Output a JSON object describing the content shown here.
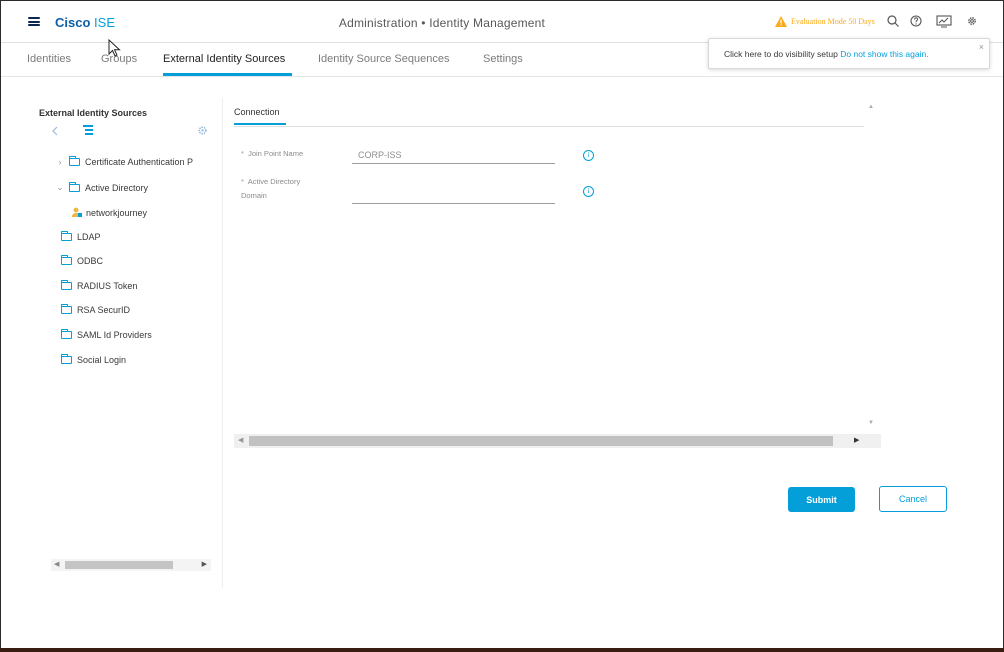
{
  "header": {
    "brand_bold": "Cisco",
    "brand_light": "ISE",
    "title": "Administration • Identity Management",
    "evaluation": "Evaluation Mode 50 Days",
    "icons": [
      "search-icon",
      "help-icon",
      "dashboard-icon",
      "gear-icon"
    ]
  },
  "tabs": [
    {
      "label": "Identities"
    },
    {
      "label": "Groups"
    },
    {
      "label": "External Identity Sources"
    },
    {
      "label": "Identity Source Sequences"
    },
    {
      "label": "Settings"
    }
  ],
  "popup": {
    "message": "Click here to do visibility setup",
    "link": "Do not show this again.",
    "close": "×"
  },
  "sidebar": {
    "title": "External Identity Sources",
    "items": [
      {
        "label": "Certificate Authentication P"
      },
      {
        "label": "Active Directory"
      },
      {
        "label": "networkjourney"
      },
      {
        "label": "LDAP"
      },
      {
        "label": "ODBC"
      },
      {
        "label": "RADIUS Token"
      },
      {
        "label": "RSA SecurID"
      },
      {
        "label": "SAML Id Providers"
      },
      {
        "label": "Social Login"
      }
    ]
  },
  "connection": {
    "tab_label": "Connection",
    "join_point_label": "Join Point Name",
    "join_point_value": "CORP-ISS",
    "ad_domain_label_1": "Active Directory",
    "ad_domain_label_2": "Domain",
    "ad_domain_value": "",
    "required_marker": "*"
  },
  "buttons": {
    "submit": "Submit",
    "cancel": "Cancel"
  },
  "colors": {
    "accent": "#049fd9",
    "warning": "#fbab18",
    "brand": "#0d5fa8"
  }
}
